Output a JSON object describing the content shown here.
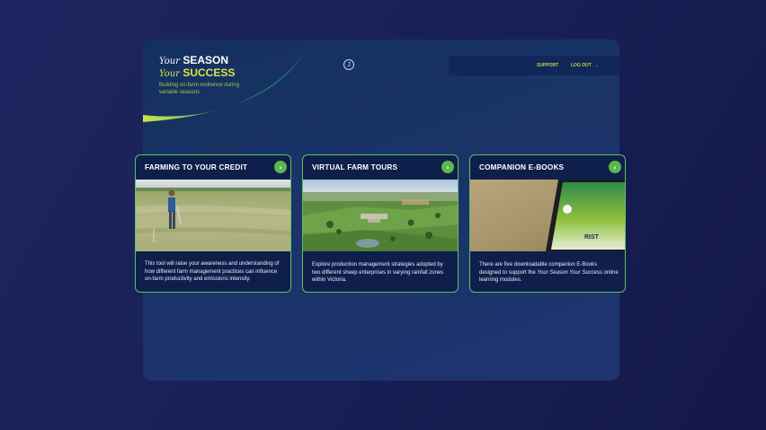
{
  "header": {
    "logo": {
      "line1_your": "Your",
      "line1_word": "SEASON",
      "line2_your": "Your",
      "line2_word": "SUCCESS"
    },
    "tagline": "Building on-farm resilience during variable seasons",
    "avatar_initial": "J",
    "support_label": "SUPPORT",
    "logout_label": "LOG OUT",
    "logout_arrow": "→"
  },
  "cards": [
    {
      "title": "FARMING TO YOUR CREDIT",
      "arrow": "›",
      "description": "This tool will raise your awareness and understanding of how different farm management practices can influence on-farm productivity and emissions intensity."
    },
    {
      "title": "VIRTUAL FARM TOURS",
      "arrow": "›",
      "description": "Explore production management strategies adopted by two different sheep enterprises in varying rainfall zones within Victoria."
    },
    {
      "title": "COMPANION E-BOOKS",
      "arrow": "›",
      "description_pre": "There are five downloadable companion E-Books designed to support the ",
      "description_em": "Your Season Your Success",
      "description_post": " online learning modules.",
      "ebook_cover_text": "RIST"
    }
  ],
  "colors": {
    "accent_green": "#5bb94a",
    "lime": "#d6e84a",
    "panel": "#1a3468",
    "card_bg": "#0f1f4b"
  }
}
